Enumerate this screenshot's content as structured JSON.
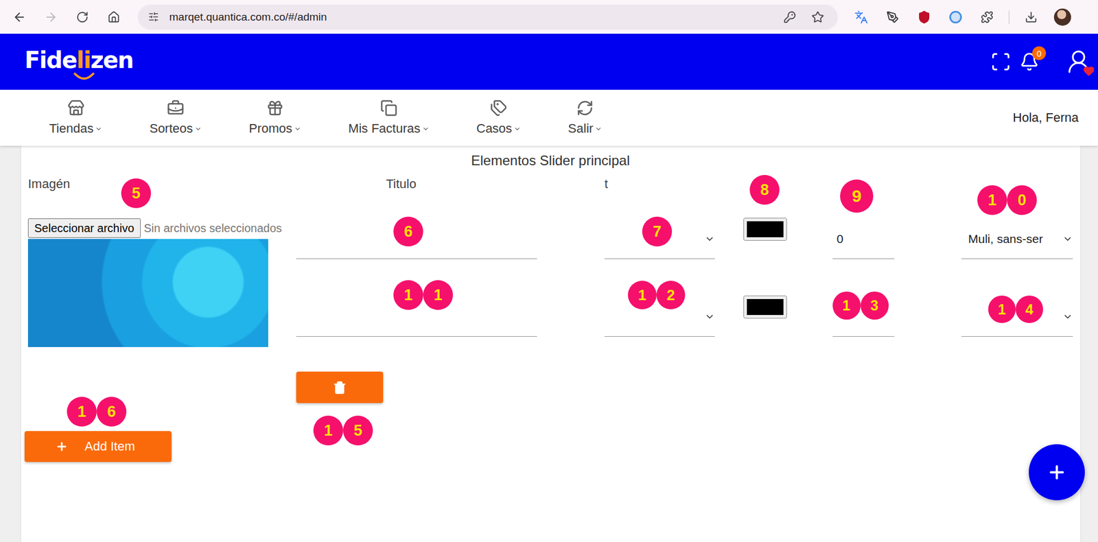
{
  "browser": {
    "url": "marqet.quantica.com.co/#/admin",
    "back_enabled": true,
    "forward_enabled": false
  },
  "header": {
    "logo": [
      {
        "text": "Fide",
        "highlight": false
      },
      {
        "text": "li",
        "highlight": true
      },
      {
        "text": "zen",
        "highlight": false
      }
    ],
    "notifications": "0"
  },
  "nav": {
    "items": [
      {
        "label": "Tiendas"
      },
      {
        "label": "Sorteos"
      },
      {
        "label": "Promos"
      },
      {
        "label": "Mis Facturas"
      },
      {
        "label": "Casos"
      },
      {
        "label": "Salir"
      }
    ],
    "greeting": "Hola, Ferna"
  },
  "panel": {
    "title": "Elementos Slider principal",
    "columns": [
      "Imagén",
      "Titulo",
      "t"
    ],
    "file_input": {
      "button": "Seleccionar archivo",
      "status": "Sin archivos seleccionados"
    },
    "rows": [
      {
        "swatch": "#000000",
        "number": "0",
        "font": "Muli, sans-ser"
      },
      {
        "swatch": "#000000"
      }
    ],
    "add_button": "Add Item"
  },
  "annotations": [
    {
      "digits": [
        "5"
      ]
    },
    {
      "digits": [
        "6"
      ]
    },
    {
      "digits": [
        "7"
      ]
    },
    {
      "digits": [
        "8"
      ]
    },
    {
      "digits": [
        "9"
      ]
    },
    {
      "digits": [
        "1",
        "0"
      ]
    },
    {
      "digits": [
        "1",
        "1"
      ]
    },
    {
      "digits": [
        "1",
        "2"
      ]
    },
    {
      "digits": [
        "1",
        "3"
      ]
    },
    {
      "digits": [
        "1",
        "4"
      ]
    },
    {
      "digits": [
        "1",
        "5"
      ]
    },
    {
      "digits": [
        "1",
        "6"
      ]
    }
  ]
}
